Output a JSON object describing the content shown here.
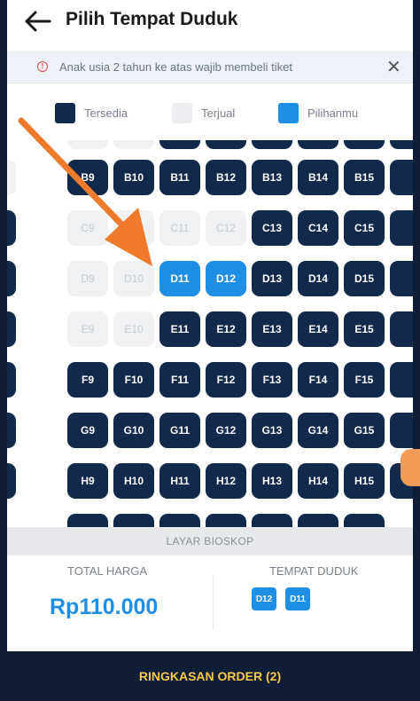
{
  "header": {
    "title": "Pilih Tempat Duduk"
  },
  "notice": {
    "text": "Anak usia 2 tahun ke atas wajib membeli tiket"
  },
  "legend": [
    {
      "label": "Tersedia",
      "color": "#112a4b"
    },
    {
      "label": "Terjual",
      "color": "#f0f1f3"
    },
    {
      "label": "Pilihanmu",
      "color": "#1f8fe6"
    }
  ],
  "seat_rows": [
    {
      "row": "B",
      "seats": [
        {
          "label": "B9",
          "status": "available"
        },
        {
          "label": "B10",
          "status": "available"
        },
        {
          "label": "B11",
          "status": "available"
        },
        {
          "label": "B12",
          "status": "available"
        },
        {
          "label": "B13",
          "status": "available"
        },
        {
          "label": "B14",
          "status": "available"
        },
        {
          "label": "B15",
          "status": "available"
        }
      ]
    },
    {
      "row": "C",
      "seats": [
        {
          "label": "C9",
          "status": "sold"
        },
        {
          "label": "C10",
          "status": "sold"
        },
        {
          "label": "C11",
          "status": "sold"
        },
        {
          "label": "C12",
          "status": "sold"
        },
        {
          "label": "C13",
          "status": "available"
        },
        {
          "label": "C14",
          "status": "available"
        },
        {
          "label": "C15",
          "status": "available"
        }
      ]
    },
    {
      "row": "D",
      "seats": [
        {
          "label": "D9",
          "status": "sold"
        },
        {
          "label": "D10",
          "status": "sold"
        },
        {
          "label": "D11",
          "status": "selected"
        },
        {
          "label": "D12",
          "status": "selected"
        },
        {
          "label": "D13",
          "status": "available"
        },
        {
          "label": "D14",
          "status": "available"
        },
        {
          "label": "D15",
          "status": "available"
        }
      ]
    },
    {
      "row": "E",
      "seats": [
        {
          "label": "E9",
          "status": "sold"
        },
        {
          "label": "E10",
          "status": "sold"
        },
        {
          "label": "E11",
          "status": "available"
        },
        {
          "label": "E12",
          "status": "available"
        },
        {
          "label": "E13",
          "status": "available"
        },
        {
          "label": "E14",
          "status": "available"
        },
        {
          "label": "E15",
          "status": "available"
        }
      ]
    },
    {
      "row": "F",
      "seats": [
        {
          "label": "F9",
          "status": "available"
        },
        {
          "label": "F10",
          "status": "available"
        },
        {
          "label": "F11",
          "status": "available"
        },
        {
          "label": "F12",
          "status": "available"
        },
        {
          "label": "F13",
          "status": "available"
        },
        {
          "label": "F14",
          "status": "available"
        },
        {
          "label": "F15",
          "status": "available"
        }
      ]
    },
    {
      "row": "G",
      "seats": [
        {
          "label": "G9",
          "status": "available"
        },
        {
          "label": "G10",
          "status": "available"
        },
        {
          "label": "G11",
          "status": "available"
        },
        {
          "label": "G12",
          "status": "available"
        },
        {
          "label": "G13",
          "status": "available"
        },
        {
          "label": "G14",
          "status": "available"
        },
        {
          "label": "G15",
          "status": "available"
        }
      ]
    },
    {
      "row": "H",
      "seats": [
        {
          "label": "H9",
          "status": "available"
        },
        {
          "label": "H10",
          "status": "available"
        },
        {
          "label": "H11",
          "status": "available"
        },
        {
          "label": "H12",
          "status": "available"
        },
        {
          "label": "H13",
          "status": "available"
        },
        {
          "label": "H14",
          "status": "available"
        },
        {
          "label": "H15",
          "status": "available"
        }
      ]
    }
  ],
  "screen_label": "LAYAR BIOSKOP",
  "summary": {
    "total_label": "TOTAL HARGA",
    "total_price": "Rp110.000",
    "seats_label": "TEMPAT DUDUK",
    "selected_seats": [
      "D12",
      "D11"
    ]
  },
  "cta": {
    "label": "RINGKASAN ORDER (2)"
  },
  "colors": {
    "accent": "#1f8fe6",
    "navy": "#112a4b",
    "cta_text": "#f7c948",
    "pointer_arrow": "#f07a2c"
  }
}
